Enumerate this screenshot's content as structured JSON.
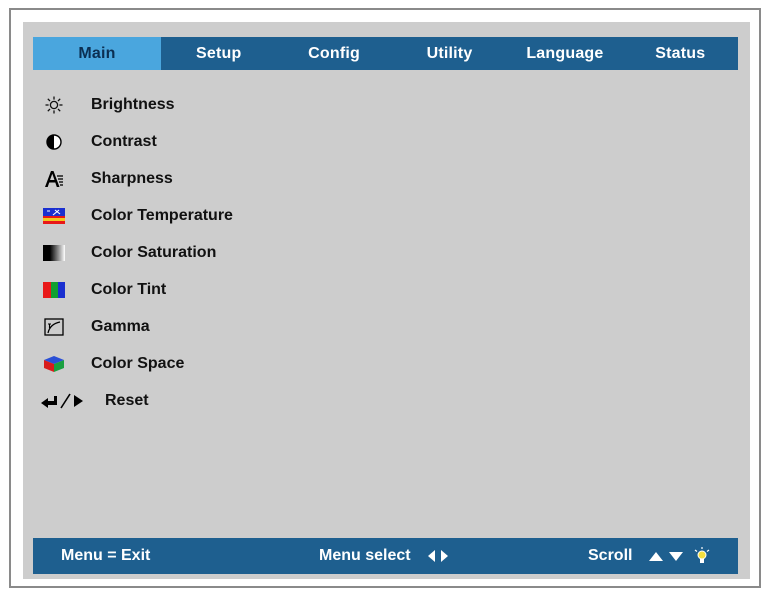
{
  "tabs": [
    {
      "label": "Main",
      "active": true
    },
    {
      "label": "Setup",
      "active": false
    },
    {
      "label": "Config",
      "active": false
    },
    {
      "label": "Utility",
      "active": false
    },
    {
      "label": "Language",
      "active": false
    },
    {
      "label": "Status",
      "active": false
    }
  ],
  "menu": {
    "items": [
      {
        "label": "Brightness",
        "icon": "brightness-icon"
      },
      {
        "label": "Contrast",
        "icon": "contrast-icon"
      },
      {
        "label": "Sharpness",
        "icon": "sharpness-icon"
      },
      {
        "label": "Color Temperature",
        "icon": "color-temperature-icon"
      },
      {
        "label": "Color Saturation",
        "icon": "color-saturation-icon"
      },
      {
        "label": "Color Tint",
        "icon": "color-tint-icon"
      },
      {
        "label": "Gamma",
        "icon": "gamma-icon"
      },
      {
        "label": "Color Space",
        "icon": "color-space-icon"
      },
      {
        "label": "Reset",
        "icon": "enter-right-icon"
      }
    ]
  },
  "statusbar": {
    "exit": "Menu = Exit",
    "select": "Menu select",
    "scroll": "Scroll"
  },
  "colors": {
    "bar": "#1e5f8f",
    "active_tab": "#4aa6de",
    "panel": "#cdcdcd"
  }
}
